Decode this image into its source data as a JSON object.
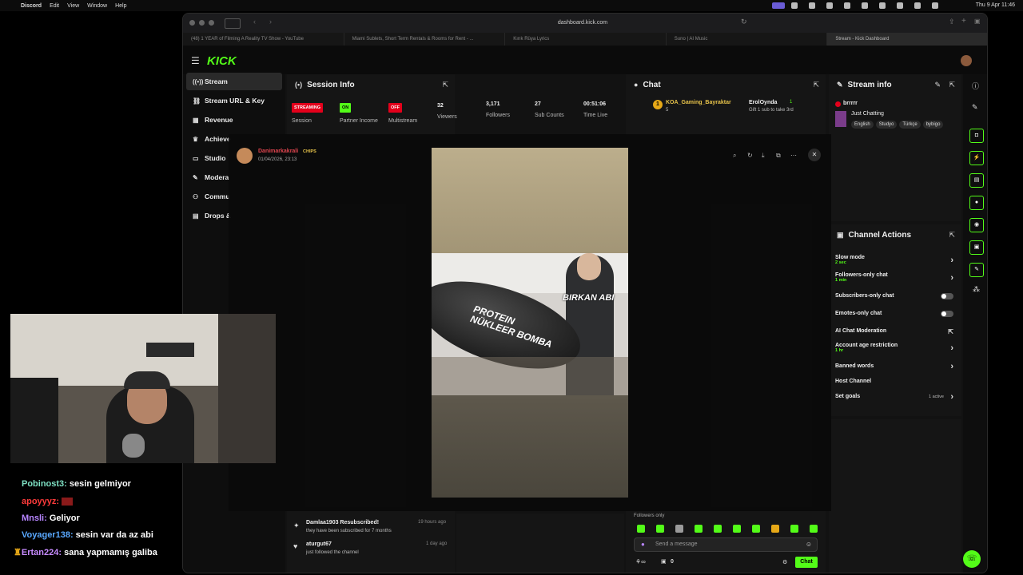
{
  "menubar": {
    "items": [
      "Discord",
      "Edit",
      "View",
      "Window",
      "Help"
    ],
    "clock": "Thu 9 Apr  11:46"
  },
  "browser": {
    "url": "dashboard.kick.com",
    "tabs": [
      "(48) 1 YEAR of Filming A Reality TV Show - YouTube",
      "Miami Sublets, Short Term Rentals & Rooms for Rent - ...",
      "Kırık Rüya Lyrics",
      "Suno | AI Music",
      "Stream - Kick Dashboard"
    ]
  },
  "kick": {
    "logo": "KICK",
    "nav": [
      {
        "label": "Stream",
        "icon": "broadcast-icon"
      },
      {
        "label": "Stream URL & Key",
        "icon": "link-icon"
      },
      {
        "label": "Revenue",
        "icon": "revenue-icon"
      },
      {
        "label": "Achieve",
        "icon": "trophy-icon"
      },
      {
        "label": "Studio",
        "icon": "monitor-icon"
      },
      {
        "label": "Modera",
        "icon": "wrench-icon"
      },
      {
        "label": "Commu",
        "icon": "community-icon"
      },
      {
        "label": "Drops &",
        "icon": "drops-icon"
      }
    ],
    "session": {
      "title": "Session Info",
      "stats": [
        {
          "badge": "STREAMING",
          "label": "Session"
        },
        {
          "badge": "ON",
          "label": "Partner Income"
        },
        {
          "badge": "OFF",
          "label": "Multistream"
        },
        {
          "value": "32",
          "label": "Viewers"
        },
        {
          "value": "3,171",
          "label": "Followers"
        },
        {
          "value": "27",
          "label": "Sub Counts"
        },
        {
          "value": "00:51:06",
          "label": "Time Live"
        }
      ]
    },
    "chat": {
      "title": "Chat",
      "top_gifter": "KOA_Gaming_Bayraktar",
      "top_gifter_rank": "1",
      "top_gifter_count": "5",
      "second": "ErolOynda",
      "second_count": "1",
      "gift_hint": "Gift 1 sub to take 3rd",
      "followers_only": "Followers only",
      "input_placeholder": "Send a message",
      "chat_button": "Chat",
      "points": "0"
    },
    "stream_info": {
      "title": "Stream info",
      "stream_title": "brrrrr",
      "category": "Just Chatting",
      "tags": [
        "English",
        "Studyo",
        "Türkçe",
        "bybigo"
      ]
    },
    "channel_actions": {
      "title": "Channel Actions",
      "rows": [
        {
          "label": "Slow mode",
          "sub": "2 sec",
          "kind": "chevron"
        },
        {
          "label": "Followers-only chat",
          "sub": "1 min",
          "kind": "chevron"
        },
        {
          "label": "Subscribers-only chat",
          "sub": "",
          "kind": "toggle"
        },
        {
          "label": "Emotes-only chat",
          "sub": "",
          "kind": "toggle"
        },
        {
          "label": "AI Chat Moderation",
          "sub": "",
          "kind": "external"
        },
        {
          "label": "Account age restriction",
          "sub": "1 hr",
          "kind": "chevron"
        },
        {
          "label": "Banned words",
          "sub": "",
          "kind": "chevron"
        },
        {
          "label": "Host Channel",
          "sub": "",
          "kind": "none"
        },
        {
          "label": "Set goals",
          "sub": "",
          "kind": "goals",
          "extra": "1 active"
        }
      ]
    },
    "activity": [
      {
        "title": "Damlaa1903 Resubscribed!",
        "desc": "they have been subscribed for 7 months",
        "time": "19 hours ago"
      },
      {
        "title": "aturgut67",
        "desc": "just followed the channel",
        "time": "1 day ago"
      }
    ]
  },
  "viewer": {
    "author": "Danimarkakrali",
    "badge": "CHIPS",
    "date": "01/04/2026, 23:13",
    "meme_text_1": "PROTEIN NÜKLEER BOMBA",
    "meme_text_2": "BIRKAN ABI"
  },
  "overlay_chat": [
    {
      "user": "Pobinost3:",
      "msg": "sesin gelmiyor",
      "color": "#7ee0c3"
    },
    {
      "user": "apoyyyz:",
      "msg": "",
      "color": "#ff3b3b"
    },
    {
      "user": "Mnsli:",
      "msg": "Geliyor",
      "color": "#b785ff"
    },
    {
      "user": "Voyager138:",
      "msg": "sesin var da az abi",
      "color": "#59a8ff"
    },
    {
      "user": "Ertan224:",
      "msg": "sana yapmamış galiba",
      "color": "#c78bff"
    }
  ]
}
